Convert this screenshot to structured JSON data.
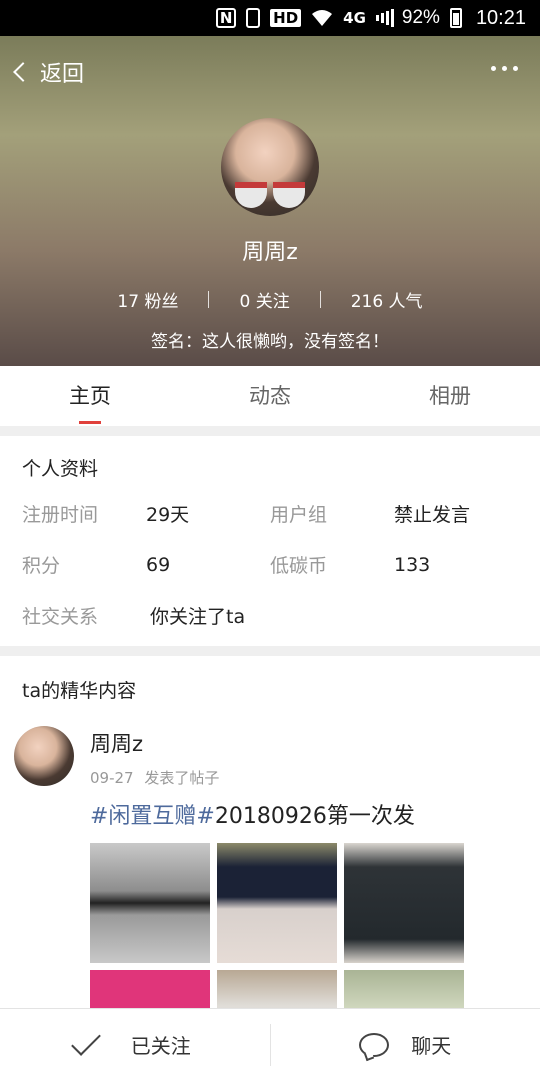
{
  "status_bar": {
    "nfc": "N",
    "hd": "HD",
    "network": "4G",
    "battery": "92%",
    "time": "10:21"
  },
  "header": {
    "back_label": "返回",
    "name": "周周z",
    "stats": [
      {
        "label": "17 粉丝"
      },
      {
        "label": "0 关注"
      },
      {
        "label": "216 人气"
      }
    ],
    "signature": "签名：这人很懒哟，没有签名！"
  },
  "tabs": [
    {
      "label": "主页",
      "active": true
    },
    {
      "label": "动态",
      "active": false
    },
    {
      "label": "相册",
      "active": false
    }
  ],
  "profile_info": {
    "title": "个人资料",
    "rows": [
      {
        "label1": "注册时间",
        "value1": "29天",
        "label2": "用户组",
        "value2": "禁止发言"
      },
      {
        "label1": "积分",
        "value1": "69",
        "label2": "低碳币",
        "value2": "133"
      },
      {
        "label1": "社交关系",
        "value1": "你关注了ta"
      }
    ]
  },
  "featured": {
    "title": "ta的精华内容",
    "post": {
      "author": "周周z",
      "date": "09-27",
      "action": "发表了帖子",
      "tag": "#闲置互赠#",
      "title_rest": "20180926第一次发"
    }
  },
  "bottom_bar": {
    "follow_label": "已关注",
    "chat_label": "聊天"
  },
  "colors": {
    "accent": "#e0403b",
    "tag": "#4e6a9c"
  }
}
